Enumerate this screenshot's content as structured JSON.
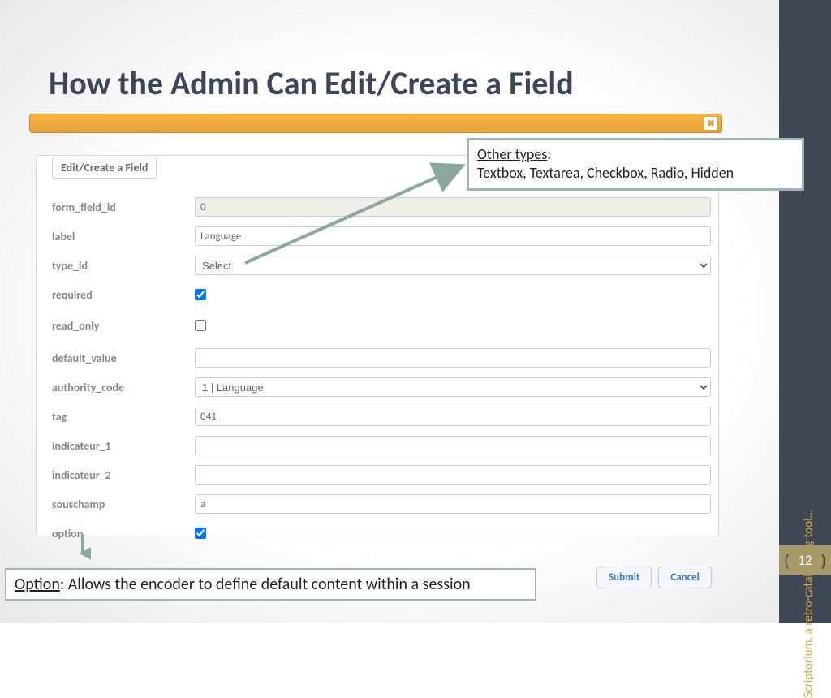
{
  "title": "How the Admin Can Edit/Create a Field",
  "side_text": "Scriptorium, a retro-cataloguing tool…",
  "page_num": "12",
  "legend": "Edit/Create a Field",
  "fields": {
    "form_field_id": {
      "label": "form_field_id",
      "value": "0"
    },
    "label": {
      "label": "label",
      "value": "Language"
    },
    "type_id": {
      "label": "type_id",
      "value": "Select"
    },
    "required": {
      "label": "required"
    },
    "read_only": {
      "label": "read_only"
    },
    "default_value": {
      "label": "default_value",
      "value": ""
    },
    "authority_code": {
      "label": "authority_code",
      "value": "1 | Language"
    },
    "tag": {
      "label": "tag",
      "value": "041"
    },
    "indicateur_1": {
      "label": "indicateur_1",
      "value": ""
    },
    "indicateur_2": {
      "label": "indicateur_2",
      "value": ""
    },
    "souschamp": {
      "label": "souschamp",
      "value": "a"
    },
    "option": {
      "label": "option"
    }
  },
  "callout_types": {
    "head": "Other types",
    "rest": ":",
    "body": "Textbox, Textarea, Checkbox, Radio, Hidden"
  },
  "callout_option": {
    "head": "Option",
    "rest": ": Allows the encoder to define default content within a session"
  },
  "buttons": {
    "submit": "Submit",
    "cancel": "Cancel"
  }
}
